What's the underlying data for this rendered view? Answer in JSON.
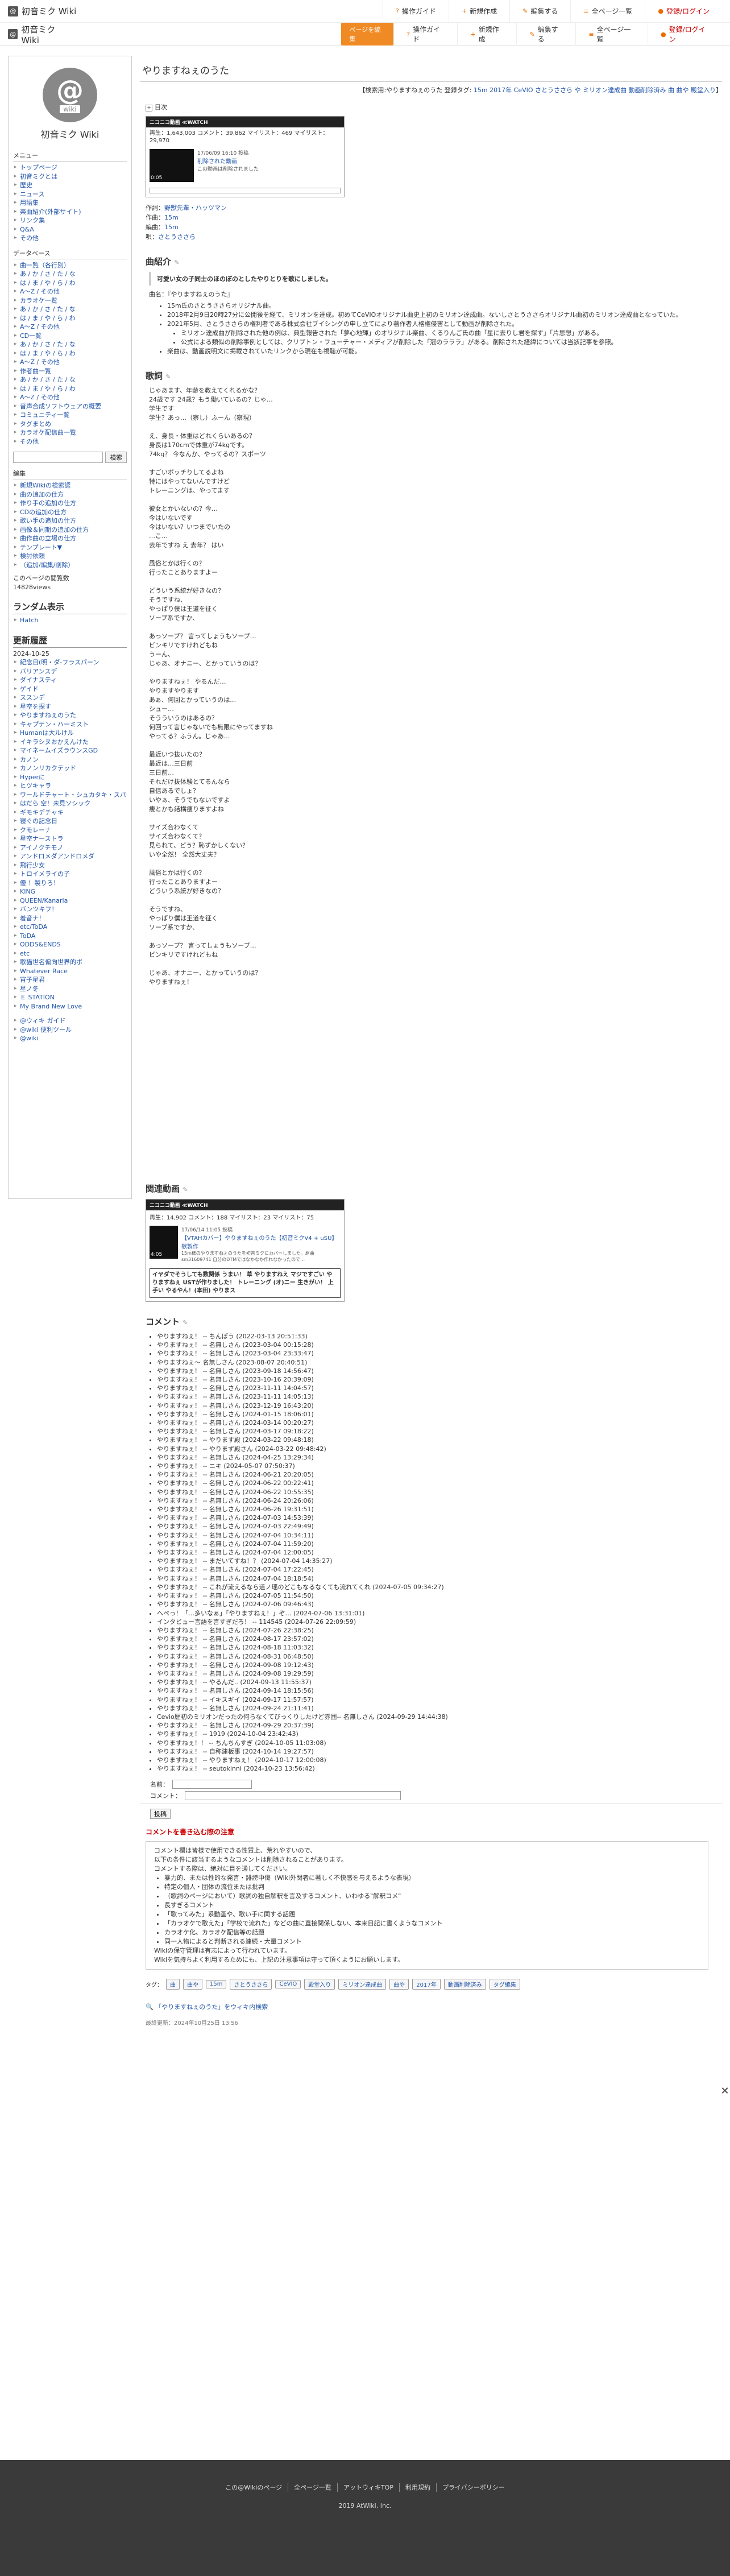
{
  "site": {
    "name": "初音ミク Wiki",
    "sidebar_name": "初音ミク Wiki",
    "logo_text": "wiki",
    "logo_glyph": "@"
  },
  "topnav": {
    "guide": "操作ガイド",
    "new": "新規作成",
    "edit": "編集する",
    "all_pages": "全ページ一覧",
    "login": "登録/ログイン",
    "edit_page_btn": "ページを編集"
  },
  "page": {
    "title": "やりますねぇのうた"
  },
  "tagline": {
    "prefix": "【検索用:",
    "text": "やりますねぇのうた 登録タグ:",
    "tags": "15m 2017年 CeVIO さとうささら や ミリオン達成曲 動画削除済み 曲 曲や 殿堂入り",
    "suffix": "】"
  },
  "toc": {
    "label": "目次"
  },
  "video1": {
    "brand": "ニコニコ動画 ≪WATCH",
    "stats": "再生：1,643,003 コメント：39,862 マイリスト：469 マイリスト：29,970",
    "date": "17/06/09 16:10 投稿",
    "vtitle": "削除された動画",
    "vdesc": "この動画は削除されました",
    "time": "0:05"
  },
  "credits": {
    "l1k": "作詞：",
    "l1v": "野獣先輩・ハッツマン",
    "l2k": "作曲：",
    "l2v": "15m",
    "l3k": "編曲：",
    "l3v": "15m",
    "l4k": "唄：",
    "l4v": "さとうささら"
  },
  "section_intro": {
    "title": "曲紹介",
    "quote": "可愛い女の子同士のほのぼのとしたやりとりを歌にしました。",
    "name_line": "曲名：『やりますねぇのうた』",
    "bullets": [
      "15m氏のさとうささらオリジナル曲。",
      "2018年2月9日20時27分に公開後を経て、ミリオンを達成。初めてCeVIOオリジナル曲史上初のミリオン達成曲。ないしさとうささらオリジナル曲初のミリオン達成曲となっていた。",
      "2021年5月、さとうささらの権利者である株式会社ブイシングの申し立てにより著作者人格権侵害として動画が削除された。"
    ],
    "sub_bullets": [
      "ミリオン達成曲が削除された他の例は、典型報告された「夢心地輝」のオリジナル楽曲、くるりんご氏の曲「星に去りし君を探す」「片思想」がある。",
      "公式による類似の削除事例としては、クリプトン・フューチャー・メディアが削除した「冠のラララ」がある。削除された経緯については当該記事を参照。"
    ],
    "last_bullet": "楽曲は、動画説明文に掲載されていたリンクから現在も視聴が可能。"
  },
  "section_lyrics": {
    "title": "歌詞",
    "text": "じゃあます、年齢を教えてくれるかな？\n24歳です 24歳？もう働いているの？じゃ…\n学生です\n学生？あっ…（察し）ふーん（察現）\n\nえ、身長・体重はどれくらいあるの？\n身長は170cmで体重が74kgです。\n74kg？ 今なんか、やってるの？スポーツ\n\nすごいボッチりしてるよね\n特にはやってないんですけど\nトレーニングは、やってます\n\n彼女とかいないの？今…\n今はいないです\n今はいない？いつまでいたの\n…こ…\n去年ですね え 去年？ はい\n\n風俗とかは行くの？\n行ったことありますよー\n\nどういう系統が好きなの？\nそうですね、\nやっぱり僕は王道を征く\nソープ系ですか、\n\nあっソープ？ 言ってしょうもソープ…\nビンキリですけれどもね\nうーん、\nじゃあ、オナニー、とかっていうのは？\n\nやりますねぇ！ やるんだ…\nやりますやります\nあぁ、何回とかっていうのは…\nシュー…\nそうういうのはあるの？\n何回って言じゃないでも無限にやってますね\nやってる？ふうん。じゃあ…\n\n最近いつ抜いたの？\n最近は…三日前\n三日前…\nそれだけ抜体験とてるんなら\n自信あるでしょ？\nいやぁ、そうでもないですよ\n痩とかも結構痩りますよね\n\nサイズ合わなくて\nサイズ合わなくて？\n見られて、どう？恥ずかしくない？\nいや全然！ 全然大丈夫？\n\n風俗とかは行くの？\n行ったことありますよー\nどういう系統が好きなの？\n\nそうですね、\nやっぱり僕は王道を征く\nソープ系ですか、\n\nあっソープ？ 言ってしょうもソープ…\nビンキリですけれどもね\n\nじゃあ、オナニー、とかっていうのは？\nやりますねぇ！"
  },
  "section_related": {
    "title": "関連動画",
    "brand": "ニコニコ動画 ≪WATCH",
    "stats": "再生：14,902 コメント：188 マイリスト：23 マイリスト：75",
    "date": "17/06/14 11:05 投稿",
    "vtitle": "【VTAHカバー】やりますねぇのうた【初音ミクV4 + uSU】歌製作",
    "vdesc": "15m様のやりますねぇのうたを初音ミクにカバーしました。原曲sm31609741 自分のDTMではなかなか作れなかったので…",
    "time": "4:05",
    "blk": "イヤダでそうしても数関係 うまい！ 草 やりますねえ マジですごい やりますねぇ USTが作りました！ トレーニング (オ)ニー 生きがい！ 上手い やるやん！(本田) やりまス"
  },
  "section_comments": {
    "title": "コメント",
    "items": [
      "やりますねぇ！ -- ちんぽう (2022-03-13 20:51:33)",
      "やりますねぇ！ -- 名無しさん (2023-03-04 00:15:28)",
      "やりますねぇ！ -- 名無しさん (2023-03-04 23:33:47)",
      "やりますねぇ～ 名無しさん (2023-08-07 20:40:51)",
      "やりますねぇ！ -- 名無しさん (2023-09-18 14:56:47)",
      "やりますねぇ！ -- 名無しさん (2023-10-16 20:39:09)",
      "やりますねぇ！ -- 名無しさん (2023-11-11 14:04:57)",
      "やりますねぇ！ -- 名無しさん (2023-11-11 14:05:13)",
      "やりますねぇ！ -- 名無しさん (2023-12-19 16:43:20)",
      "やりますねぇ！ -- 名無しさん (2024-01-15 18:06:01)",
      "やりますねぇ！ -- 名無しさん (2024-03-14 00:20:27)",
      "やりますねぇ！ -- 名無しさん (2024-03-17 09:18:22)",
      "やりますねぇ！ -- やります殿 (2024-03-22 09:48:18)",
      "やりますねぇ！ -- やりまず殿さん (2024-03-22 09:48:42)",
      "やりますねぇ！ -- 名無しさん (2024-04-25 13:29:34)",
      "やりますねぇ！ -- ニキ (2024-05-07 07:50:37)",
      "やりますねぇ！ -- 名無しさん (2024-06-21 20:20:05)",
      "やりますねぇ！ -- 名無しさん (2024-06-22 00:22:41)",
      "やりますねぇ！ -- 名無しさん (2024-06-22 10:55:35)",
      "やりますねぇ！ -- 名無しさん (2024-06-24 20:26:06)",
      "やりますねぇ！ -- 名無しさん (2024-06-26 19:31:51)",
      "やりますねぇ！ -- 名無しさん (2024-07-03 14:53:39)",
      "やりますねぇ！ -- 名無しさん (2024-07-03 22:49:49)",
      "やりますねぇ！ -- 名無しさん (2024-07-04 10:34:11)",
      "やりますねぇ！ -- 名無しさん (2024-07-04 11:59:20)",
      "やりますねぇ！ -- 名無しさん (2024-07-04 12:00:05)",
      "やりますねぇ！ -- まだいてすね！？ (2024-07-04 14:35:27)",
      "やりますねぇ！ -- 名無しさん (2024-07-04 17:22:45)",
      "やりますねぇ！ -- 名無しさん (2024-07-04 18:18:54)",
      "やりますねぇ！ -- これが流えるなら道ノ瑶のどこもなるなくても流れてくれ (2024-07-05 09:34:27)",
      "やりますねぇ！ -- 名無しさん (2024-07-05 11:54:50)",
      "やりますねぇ！ -- 名無しさん (2024-07-06 09:46:43)",
      "へぺっ！「…多いなぁ」「やりますねぇ！」ぞ… (2024-07-06 13:31:01)",
      "インタビュー言語を言すぎだろ！ -- 114545 (2024-07-26 22:09:59)",
      "やりますねぇ！ -- 名無しさん (2024-07-26 22:38:25)",
      "やりますねぇ！ -- 名無しさん (2024-08-17 23:57:02)",
      "やりますねぇ！ -- 名無しさん (2024-08-18 11:03:32)",
      "やりますねぇ！ -- 名無しさん (2024-08-31 06:48:50)",
      "やりますねぇ！ -- 名無しさん (2024-09-08 19:12:43)",
      "やりますねぇ！ -- 名無しさん (2024-09-08 19:29:59)",
      "やりますねぇ！ -- やるんだ.. (2024-09-13 11:55:37)",
      "やりますねぇ！ -- 名無しさん (2024-09-14 18:15:56)",
      "やりますねぇ！ -- イキスギイ (2024-09-17 11:57:57)",
      "やりますねぇ！ -- 名無しさん (2024-09-24 21:11:41)",
      "Cevio歴初のミリオンだったの何らなくてびっくりしたけど雰囲-- 名無しさん (2024-09-29 14:44:38)",
      "やりますねぇ！ -- 名無しさん (2024-09-29 20:37:39)",
      "やりますねぇ！ -- 1919 (2024-10-04 23:42:43)",
      "やりますねぇ！！ -- ちんちんすぎ (2024-10-05 11:03:08)",
      "やりますねぇ！ -- 自称建板事 (2024-10-14 19:27:57)",
      "やりますねぇ！ -- やりますねぇ！ (2024-10-17 12:00:08)",
      "やりますねぇ！ -- seutokinni (2024-10-23 13:56:42)"
    ],
    "name_label": "名前：",
    "comment_label": "コメント：",
    "post_label": "投稿",
    "close_glyph": "✕"
  },
  "notice": {
    "title": "コメントを書き込む際の注意",
    "lines": [
      "コメント欄は皆様で使用できる性質上、荒れやすいので、",
      "以下の条件に該当するようなコメントは削除されることがあります。",
      "コメントする際は、絶対に目を通してください。"
    ],
    "bullets": [
      "暴力的、または性的な発言・誹謗中傷（Wiki外関者に著しく不快感を与えるような表現）",
      "特定の個人・団体の流位または批判",
      "（歌詞のページにおいて）歌詞の独自解釈を言及するコメント、いわゆる\"解釈コメ\"",
      "長すぎるコメント",
      "「歌ってみた」系動画や、歌い手に関する話題",
      "「カラオケで歌えた」「学校で流れた」などの曲に直接関係しない、本来日記に書くようなコメント",
      "カラオケ化、カラオケ配信等の話題",
      "同一人物によると判断される連続・大量コメント"
    ],
    "tail": [
      "Wikiの保守管理は有志によって行われています。",
      "Wikiを気持ちよく利用するためにも、上記の注意事項は守って頂くようにお願いします。"
    ]
  },
  "tagsrow": {
    "label": "タグ：",
    "items": [
      "曲",
      "曲や",
      "15m",
      "さとうささら",
      "CeVIO",
      "殿堂入り",
      "ミリオン達成曲",
      "曲や",
      "2017年",
      "動画削除済み",
      "タグ編集"
    ]
  },
  "twitter": {
    "text": "「やりますねぇのうた」をウィキ内検索"
  },
  "lastupdate": {
    "text": "最終更新：2024年10月25日 13:56"
  },
  "footer": {
    "links": [
      "この@Wikiのぺージ",
      "全ページ一覧",
      "アットウィキTOP",
      "利用規約",
      "プライバシーポリシー"
    ],
    "copy": "2019 AtWiki, Inc."
  },
  "sidebar": {
    "menu_h": "メニュー",
    "menu": [
      "トップページ",
      "初音ミクとは",
      "歴史",
      "ニュース",
      "用語集",
      "楽曲紹介(外部サイト)",
      "リンク集",
      "Q&A",
      "その他"
    ],
    "db_h": "データベース",
    "db": [
      "曲一覧（各行別）",
      "あ / か / さ / た / な",
      "は / ま / や / ら / わ",
      "A〜Z / その他",
      "カラオケ一覧",
      "あ / か / さ / た / な",
      "は / ま / や / ら / わ",
      "A〜Z / その他",
      "CD一覧",
      "あ / か / さ / た / な",
      "は / ま / や / ら / わ",
      "A〜Z / その他",
      "作者曲一覧",
      "あ / か / さ / た / な",
      "は / ま / や / ら / わ",
      "A〜Z / その他",
      "音声合成ソフトウェアの概要",
      "コミュニティ一覧",
      "タグまとめ",
      "カラオケ配信曲一覧",
      "その他"
    ],
    "search_btn": "検索",
    "edit_h": "編集",
    "edit": [
      "新規Wikiの検索認",
      "曲の追加の仕方",
      "作り手の追加の仕方",
      "CDの追加の仕方",
      "歌い手の追加の仕方",
      "画像＆同期の追加の仕方",
      "曲作曲の立場の仕方",
      "テンプレート▼",
      "検討依頼",
      "（追加/編集/削除）"
    ],
    "count_label": "このページの閲覧数",
    "count": "14828views",
    "rank_h": "ランダム表示",
    "rank": [
      "Hatch"
    ],
    "hist_h": "更新履歴",
    "hist_date": "2024-10-25",
    "hist": [
      "紀念日(明・ダ-フラスパーン",
      "バリアンスデ",
      "ダイナスティ",
      "ゲイド",
      "ススンデ",
      "星空を探す",
      "やりますねぇのうた",
      "キャプテン・ハーミスト",
      "Humanは大ルけル",
      "イキラシヌおかえんけた",
      "マイネームイズラウンスGD",
      "カノン",
      "カノンリカクテッド",
      "Hyperに",
      "ヒツキャラ",
      "ワールドチャート・シュカタキ・スパチキ",
      "はだら 空！未見ソシック",
      "ギモキデチャキ",
      "寝ぐの記念日",
      "クモレーナ",
      "星空ナーストラ",
      "アイノクチモノ",
      "アンドロメダアンドロメダ",
      "飛行少女",
      "トロイメライの子",
      "優 ！製りろ！",
      "KING",
      "QUEEN/Kanaria",
      "バンツキフ！",
      "着音ナ！",
      "etc/ToDA",
      "ToDA",
      "ODDS&ENDS",
      "etc",
      "歌猫世名偏向世界的ボ",
      "Whatever Race",
      "宵子星君",
      "星ノ冬",
      "Ｅ STATION",
      "My Brand New Love"
    ],
    "foot": [
      "@ウィキ ガイド",
      "@wiki 便利ツール",
      "@wiki"
    ]
  }
}
